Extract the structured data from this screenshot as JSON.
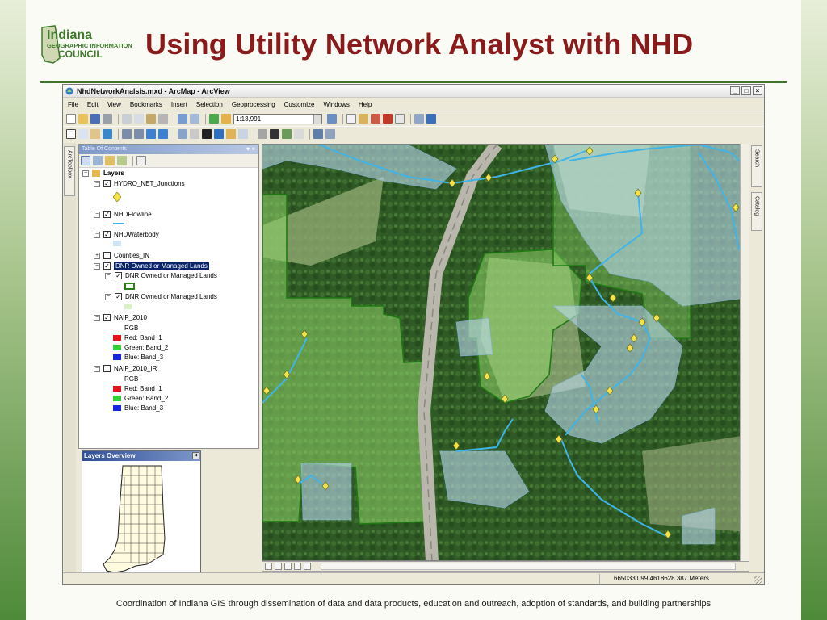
{
  "slide": {
    "title": "Using Utility Network Analyst with NHD",
    "footer": "Coordination of Indiana GIS through dissemination of data and data products, education and outreach, adoption of standards, and building partnerships",
    "logo": {
      "line1": "Indiana",
      "line2": "GEOGRAPHIC INFORMATION",
      "line3": "COUNCIL"
    },
    "colors": {
      "title": "#8b1a1a",
      "rule": "#3f7a2c"
    }
  },
  "window": {
    "title": "NhdNetworkAnalsis.mxd - ArcMap - ArcView",
    "controls": {
      "minimize": "_",
      "maximize": "□",
      "close": "×"
    },
    "menu": [
      "File",
      "Edit",
      "View",
      "Bookmarks",
      "Insert",
      "Selection",
      "Geoprocessing",
      "Customize",
      "Windows",
      "Help"
    ],
    "scale": "1:13,991",
    "left_tabs": {
      "toolbox": "ArcToolbox"
    },
    "right_tabs": {
      "search": "Search",
      "catalog": "Catalog"
    }
  },
  "toc": {
    "header": "Table Of Contents",
    "pin": "▾ ×",
    "root": "Layers",
    "layers": {
      "junctions": "HYDRO_NET_Junctions",
      "flowline": "NHDFlowline",
      "waterbody": "NHDWaterbody",
      "counties": "Counties_IN",
      "dnr_group": "DNR Owned or Managed Lands",
      "dnr_1": "DNR Owned or Managed Lands",
      "dnr_2": "DNR Owned or Managed Lands",
      "naip": "NAIP_2010",
      "naip_rgb": "RGB",
      "naip_red": "Red:   Band_1",
      "naip_green": "Green: Band_2",
      "naip_blue": "Blue:   Band_3",
      "naip_ir": "NAIP_2010_IR",
      "ir_rgb": "RGB",
      "ir_red": "Red:   Band_1",
      "ir_green": "Green: Band_2",
      "ir_blue": "Blue:   Band_3"
    },
    "symbols": {
      "junction": "#f2e34a",
      "flowline": "#3fb4e8",
      "waterbody": "#cfe4f3",
      "dnr_fill": "#b9e39c",
      "dnr_outline": "#2e7d1d",
      "red": "#e0141b",
      "green": "#2fd234",
      "blue": "#1623d6"
    }
  },
  "overview": {
    "title": "Layers Overview",
    "close": "×"
  },
  "status": {
    "coords": "665033.099  4618628.387 Meters"
  }
}
